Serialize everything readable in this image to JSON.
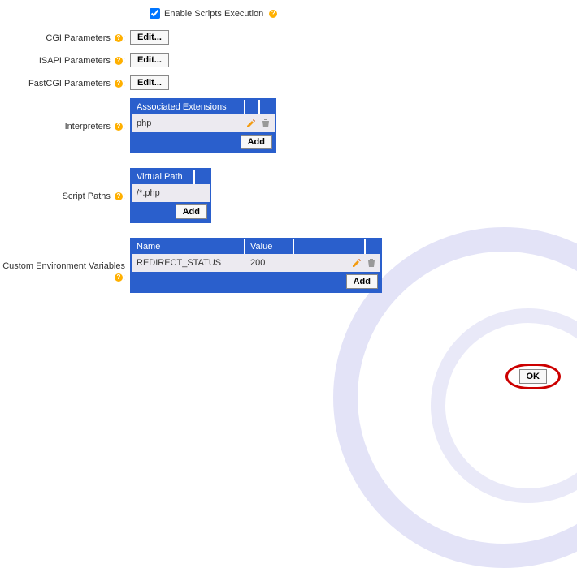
{
  "enableScripts": {
    "label": "Enable Scripts Execution",
    "checked": true
  },
  "cgi": {
    "label": "CGI Parameters",
    "button": "Edit..."
  },
  "isapi": {
    "label": "ISAPI Parameters",
    "button": "Edit..."
  },
  "fastcgi": {
    "label": "FastCGI Parameters",
    "button": "Edit..."
  },
  "interpreters": {
    "label": "Interpreters",
    "header": "Associated Extensions",
    "items": [
      "php"
    ],
    "addLabel": "Add"
  },
  "scriptPaths": {
    "label": "Script Paths",
    "header": "Virtual Path",
    "items": [
      "/*.php"
    ],
    "addLabel": "Add"
  },
  "envVars": {
    "label": "Custom Environment Variables",
    "headerName": "Name",
    "headerValue": "Value",
    "items": [
      {
        "name": "REDIRECT_STATUS",
        "value": "200"
      }
    ],
    "addLabel": "Add"
  },
  "okLabel": "OK",
  "colon": ":"
}
